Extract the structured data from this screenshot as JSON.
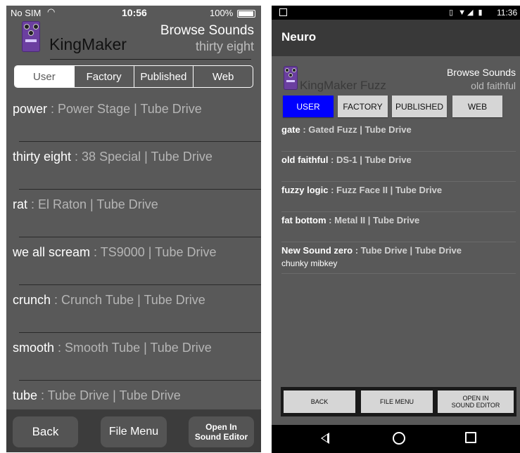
{
  "ios": {
    "status": {
      "carrier": "No SIM",
      "time": "10:56",
      "battery": "100%"
    },
    "header": {
      "app_name": "KingMaker",
      "browse_title": "Browse Sounds",
      "current_sound": "thirty eight"
    },
    "tabs": [
      "User",
      "Factory",
      "Published",
      "Web"
    ],
    "selected_tab": "User",
    "sounds": [
      {
        "name": "power",
        "meta": " : Power Stage | Tube Drive"
      },
      {
        "name": "thirty eight",
        "meta": " : 38 Special | Tube Drive"
      },
      {
        "name": "rat",
        "meta": " : El Raton | Tube Drive"
      },
      {
        "name": "we all scream",
        "meta": " : TS9000 | Tube Drive"
      },
      {
        "name": "crunch",
        "meta": " : Crunch Tube | Tube Drive"
      },
      {
        "name": "smooth",
        "meta": " : Smooth Tube | Tube Drive"
      },
      {
        "name": "tube",
        "meta": " : Tube Drive | Tube Drive"
      }
    ],
    "buttons": {
      "back": "Back",
      "file_menu": "File Menu",
      "open_line1": "Open In",
      "open_line2": "Sound Editor"
    }
  },
  "android": {
    "status": {
      "time": "11:36",
      "icons": "signal-wifi-battery"
    },
    "toolbar_title": "Neuro",
    "header": {
      "app_name": "KingMaker Fuzz",
      "browse_title": "Browse Sounds",
      "current_sound": "old faithful"
    },
    "tabs": [
      "USER",
      "FACTORY",
      "PUBLISHED",
      "WEB"
    ],
    "selected_tab": "USER",
    "colors": {
      "selected_tab": "#0000ff"
    },
    "sounds": [
      {
        "name": "gate",
        "meta": " : Gated Fuzz | Tube Drive"
      },
      {
        "name": "old faithful",
        "meta": " : DS-1 | Tube Drive"
      },
      {
        "name": "fuzzy logic",
        "meta": " : Fuzz Face II | Tube Drive"
      },
      {
        "name": "fat bottom",
        "meta": " : Metal II | Tube Drive"
      },
      {
        "name": "New Sound zero",
        "meta": " : Tube Drive | Tube Drive",
        "description": "chunky mibkey"
      }
    ],
    "buttons": {
      "back": "BACK",
      "file_menu": "FILE MENU",
      "open_line1": "OPEN IN",
      "open_line2": "SOUND EDITOR"
    }
  }
}
